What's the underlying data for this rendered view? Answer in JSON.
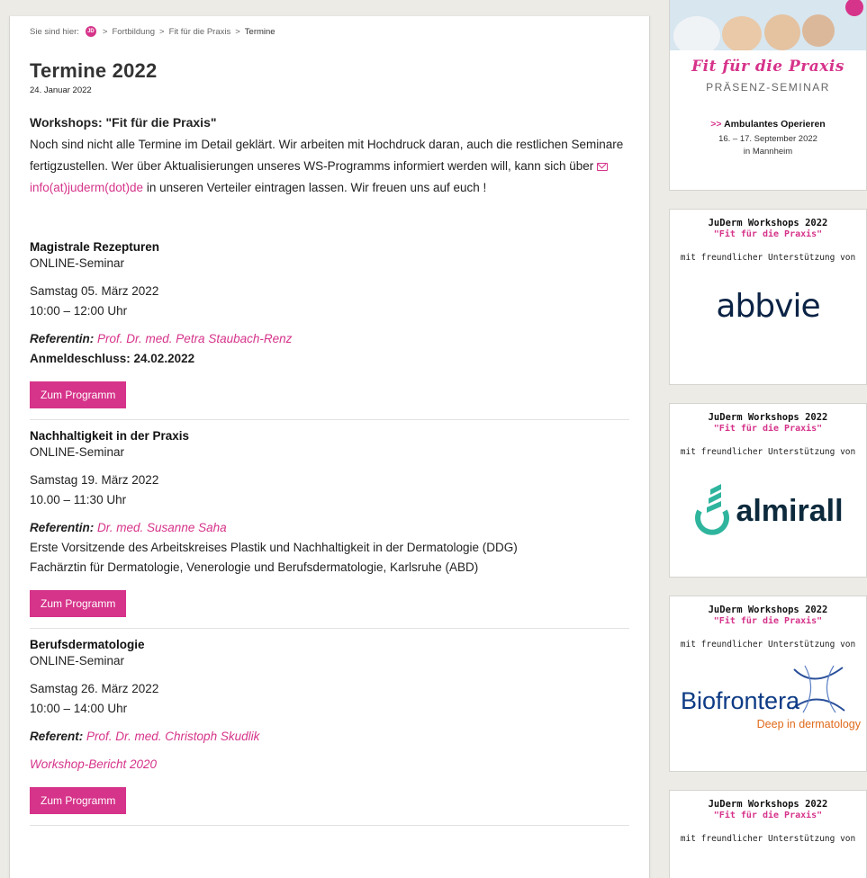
{
  "breadcrumb": {
    "prefix": "Sie sind hier:",
    "logo_text": "JD",
    "items": [
      "Fortbildung",
      "Fit für die Praxis",
      "Termine"
    ],
    "separator": ">"
  },
  "page": {
    "title": "Termine 2022",
    "date": "24. Januar 2022",
    "section_heading": "Workshops: \"Fit für die Praxis\"",
    "intro_part1": "Noch sind nicht alle Termine im Detail geklärt. Wir arbeiten mit Hochdruck daran, auch die restlichen Seminare fertigzustellen. Wer über Aktualisierungen unseres WS-Programms informiert werden will, kann sich über ",
    "intro_email": "info(at)juderm(dot)de",
    "intro_part2": " in unseren Verteiler eintragen lassen. Wir freuen uns auf euch !"
  },
  "events": [
    {
      "title": "Magistrale Rezepturen",
      "type": "ONLINE-Seminar",
      "date": "Samstag 05. März 2022",
      "time": "10:00 – 12:00 Uhr",
      "ref_label": "Referentin:",
      "ref_name": "Prof. Dr. med. Petra Staubach-Renz",
      "deadline": "Anmeldeschluss: 24.02.2022",
      "button": "Zum Programm"
    },
    {
      "title": "Nachhaltigkeit in der Praxis",
      "type": "ONLINE-Seminar",
      "date": "Samstag 19. März 2022",
      "time": "10.00 – 11:30 Uhr",
      "ref_label": "Referentin:",
      "ref_name": "Dr. med. Susanne Saha",
      "note1": "Erste Vorsitzende des Arbeitskreises Plastik und Nachhaltigkeit in der Dermatologie (DDG)",
      "note2": "Fachärztin für Dermatologie, Venerologie und Berufsdermatologie, Karlsruhe (ABD)",
      "button": "Zum Programm"
    },
    {
      "title": "Berufsdermatologie",
      "type": "ONLINE-Seminar",
      "date": "Samstag 26. März 2022",
      "time": "10:00 – 14:00 Uhr",
      "ref_label": "Referent:",
      "ref_name": "Prof. Dr. med. Christoph Skudlik",
      "report": "Workshop-Bericht 2020",
      "button": "Zum Programm"
    }
  ],
  "sidebar": {
    "banner": {
      "fit": "Fit für die Praxis",
      "praesenz": "PRÄSENZ-SEMINAR",
      "arrow": ">>",
      "event": "Ambulantes Operieren",
      "dates": "16. – 17. September 2022",
      "place": "in Mannheim"
    },
    "card_head": "JuDerm Workshops 2022",
    "card_sub": "\"Fit für die Praxis\"",
    "card_support": "mit freundlicher Unterstützung von",
    "sponsors": {
      "abbvie": "abbvie",
      "almirall": "almirall",
      "biofrontera": "Biofrontera",
      "biofrontera_tag": "Deep in dermatology"
    }
  },
  "colors": {
    "accent": "#d6338a",
    "background": "#ecebe6"
  }
}
